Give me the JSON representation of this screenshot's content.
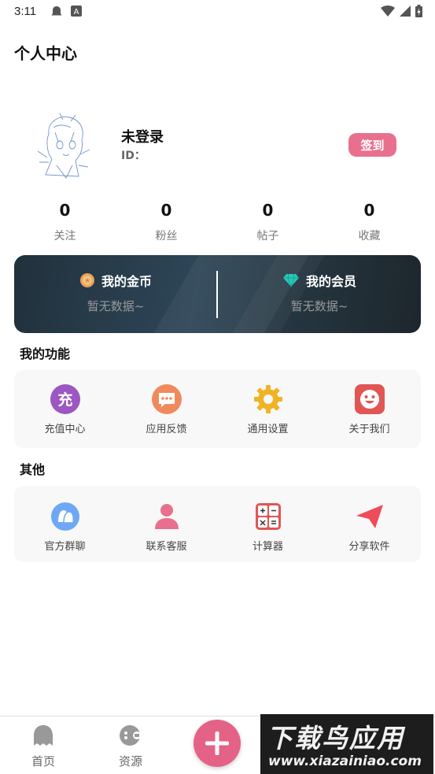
{
  "status_bar": {
    "time": "3:11"
  },
  "header": {
    "title": "个人中心"
  },
  "profile": {
    "name": "未登录",
    "id_label": "ID：",
    "checkin_label": "签到"
  },
  "stats": [
    {
      "value": "0",
      "label": "关注"
    },
    {
      "value": "0",
      "label": "粉丝"
    },
    {
      "value": "0",
      "label": "帖子"
    },
    {
      "value": "0",
      "label": "收藏"
    }
  ],
  "wallet": {
    "coins": {
      "title": "我的金币",
      "sub": "暂无数据~",
      "icon": "coin-icon"
    },
    "vip": {
      "title": "我的会员",
      "sub": "暂无数据~",
      "icon": "diamond-icon"
    }
  },
  "functions": {
    "title": "我的功能",
    "items": [
      {
        "label": "充值中心",
        "icon": "recharge-icon",
        "icon_text": "充",
        "color": "#9c57c2"
      },
      {
        "label": "应用反馈",
        "icon": "feedback-icon",
        "color": "#f08a5d"
      },
      {
        "label": "通用设置",
        "icon": "gear-icon",
        "color": "#f0b323"
      },
      {
        "label": "关于我们",
        "icon": "smile-icon",
        "color": "#e25555"
      }
    ]
  },
  "others": {
    "title": "其他",
    "items": [
      {
        "label": "官方群聊",
        "icon": "group-chat-icon",
        "color": "#6ea8f5"
      },
      {
        "label": "联系客服",
        "icon": "customer-service-icon",
        "color": "#e8708e"
      },
      {
        "label": "计算器",
        "icon": "calculator-icon",
        "color": "#e25555"
      },
      {
        "label": "分享软件",
        "icon": "send-icon",
        "color": "#ef4b5a"
      }
    ]
  },
  "bottom_nav": {
    "home": "首页",
    "resources": "资源"
  },
  "watermark": {
    "title": "下载鸟应用",
    "sub": "www.xiazainiao.com"
  }
}
